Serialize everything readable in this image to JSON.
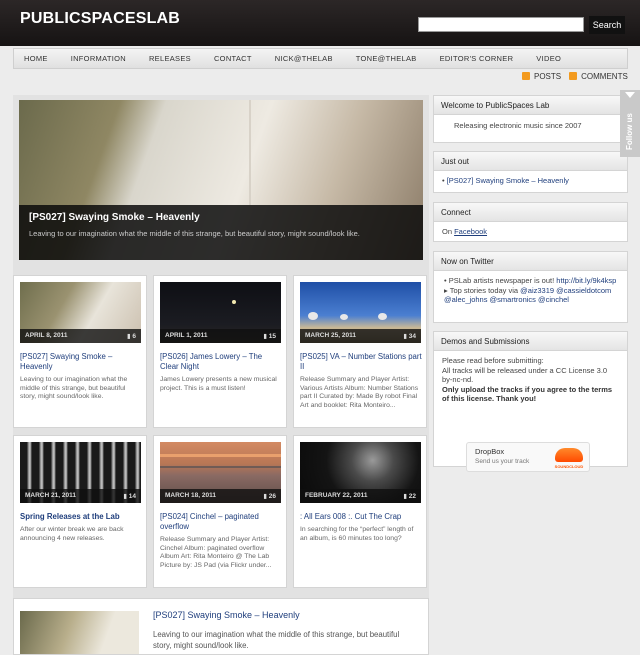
{
  "header": {
    "logo": "PUBLICSPACESLAB",
    "search_placeholder": "",
    "search_button": "Search"
  },
  "nav": [
    "HOME",
    "INFORMATION",
    "RELEASES",
    "CONTACT",
    "NICK@THELAB",
    "TONE@THELAB",
    "EDITOR'S CORNER",
    "VIDEO"
  ],
  "feeds": {
    "posts": "POSTS",
    "comments": "COMMENTS"
  },
  "featured": {
    "title": "[PS027] Swaying Smoke – Heavenly",
    "description": "Leaving to our imagination what the middle of this strange, but beautiful story, might sound/look like."
  },
  "posts": [
    {
      "date": "APRIL 8, 2011",
      "comments": "6",
      "title": "[PS027] Swaying Smoke – Heavenly",
      "excerpt": "Leaving to our imagination what the middle of this strange, but beautiful story, might sound/look like."
    },
    {
      "date": "APRIL 1, 2011",
      "comments": "15",
      "title": "[PS026] James Lowery – The Clear Night",
      "excerpt": "James Lowery presents a new musical project. This is a must listen!"
    },
    {
      "date": "MARCH 25, 2011",
      "comments": "34",
      "title": "[PS025] VA – Number Stations part II",
      "excerpt": "Release Summary and Player Artist: Various Artists Album: Number Stations part II Curated by: Made By robot Final Art and booklet: Rita Monteiro..."
    },
    {
      "date": "MARCH 21, 2011",
      "comments": "14",
      "title": "Spring Releases at the Lab",
      "excerpt": "After our winter break we are back announcing 4 new releases."
    },
    {
      "date": "MARCH 18, 2011",
      "comments": "26",
      "title": "[PS024] Cinchel – paginated overflow",
      "excerpt": "Release Summary and Player Artist: Cinchel Album: paginated overflow Album Art: Rita Monteiro @ The Lab Picture by: JS Pad (via Flickr under..."
    },
    {
      "date": "FEBRUARY 22, 2011",
      "comments": "22",
      "title": ": All Ears 008 :. Cut The Crap",
      "excerpt": "In searching for the “perfect” length of an album, is 60 minutes too long?"
    }
  ],
  "bottom_post": {
    "title": "[PS027] Swaying Smoke – Heavenly",
    "description": "Leaving to our imagination what the middle of this strange, but beautiful story, might sound/look like."
  },
  "sidebar": {
    "welcome": {
      "title": "Welcome to PublicSpaces Lab",
      "body": "Releasing electronic music since 2007"
    },
    "just_out": {
      "title": "Just out",
      "item": "[PS027] Swaying Smoke – Heavenly"
    },
    "connect": {
      "title": "Connect",
      "prefix": "On ",
      "link": "Facebook"
    },
    "twitter": {
      "title": "Now on Twitter",
      "text1": "PSLab artists newspaper is out! ",
      "link1": "http://bit.ly/9k4ksp",
      "text2": " ▸ Top stories today via ",
      "mentions": "@aiz3319 @cassieldotcom @alec_johns @smartronics @cinchel"
    },
    "demos": {
      "title": "Demos and Submissions",
      "line1": "Please read before submitting:",
      "line2": "All tracks will be released under a CC License 3.0 by-nc-nd.",
      "line3": "Only upload the tracks if you agree to the terms of this license. Thank you!",
      "dropbox_title": "DropBox",
      "dropbox_sub": "Send us your track",
      "soundcloud": "SOUNDCLOUD"
    }
  },
  "follow": "Follow us"
}
